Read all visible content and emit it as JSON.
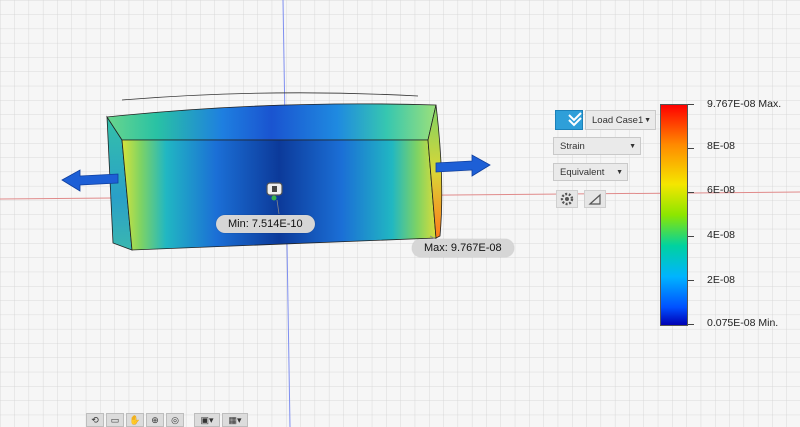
{
  "result_tags": {
    "min_label": "Min: 7.514E-10",
    "max_label": "Max: 9.767E-08"
  },
  "controls": {
    "load_case": "Load Case1",
    "result_type": "Strain",
    "component": "Equivalent",
    "icons": [
      "load-case-check-icon",
      "gear-icon",
      "probe-icon"
    ]
  },
  "legend": {
    "max_label": "9.767E-08 Max.",
    "ticks": [
      "8E-08",
      "6E-08",
      "4E-08",
      "2E-08"
    ],
    "min_label": "0.075E-08 Min.",
    "colors": [
      "#ff0000",
      "#ff8a00",
      "#f5e600",
      "#8ce600",
      "#00d2a0",
      "#00b4ff",
      "#0050ff",
      "#0000b4"
    ]
  },
  "navigation_bar": {
    "icons": [
      "orbit-icon",
      "look-at-icon",
      "pan-icon",
      "zoom-icon",
      "fit-icon",
      "display-settings-icon",
      "grid-settings-icon"
    ]
  }
}
